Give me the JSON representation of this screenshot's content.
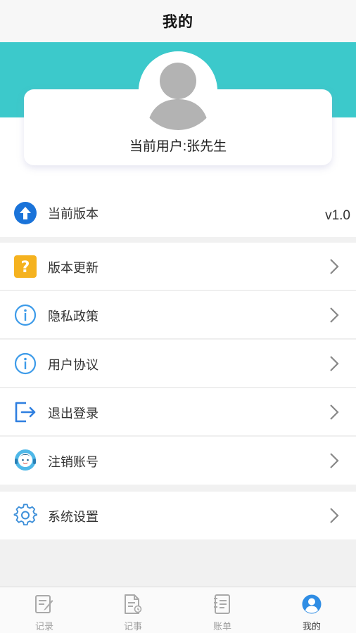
{
  "header": {
    "title": "我的"
  },
  "profile": {
    "user_label": "当前用户:张先生"
  },
  "version": {
    "label": "当前版本",
    "value": "v1.0"
  },
  "menu": [
    {
      "label": "版本更新",
      "icon": "question-icon"
    },
    {
      "label": "隐私政策",
      "icon": "info-icon"
    },
    {
      "label": "用户协议",
      "icon": "info-icon"
    },
    {
      "label": "退出登录",
      "icon": "logout-icon"
    },
    {
      "label": "注销账号",
      "icon": "support-agent-icon"
    },
    {
      "label": "系统设置",
      "icon": "gear-icon"
    }
  ],
  "tabs": [
    {
      "label": "记录",
      "icon": "edit-note-icon",
      "active": false
    },
    {
      "label": "记事",
      "icon": "document-icon",
      "active": false
    },
    {
      "label": "账单",
      "icon": "ledger-icon",
      "active": false
    },
    {
      "label": "我的",
      "icon": "user-icon",
      "active": true
    }
  ],
  "colors": {
    "teal": "#3cc9cb",
    "accent_blue": "#2f8de4",
    "question_yellow": "#f5b21f"
  }
}
